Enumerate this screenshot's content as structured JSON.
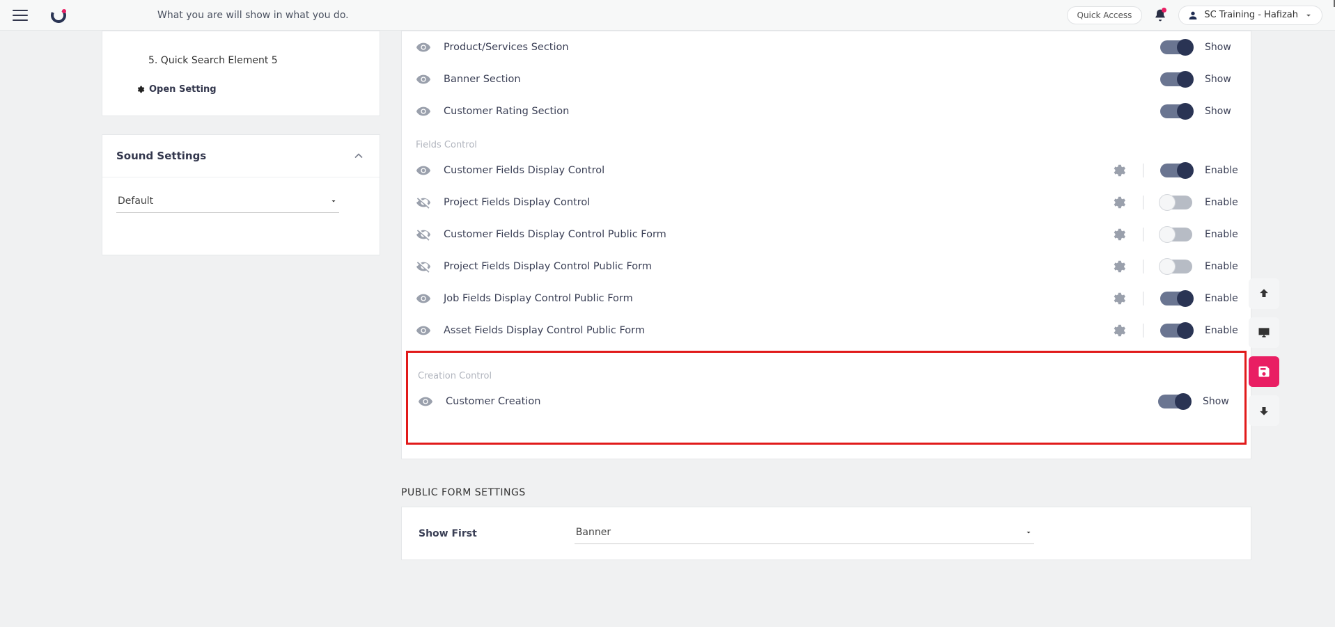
{
  "header": {
    "quote": "What you are will show in what you do.",
    "quick_access": "Quick Access",
    "user_name": "SC Training - Hafizah"
  },
  "left": {
    "qs_items": [
      "5.   Quick Search Element 5"
    ],
    "open_setting": "Open Setting",
    "sound_title": "Sound Settings",
    "sound_value": "Default"
  },
  "settings": {
    "rows_top": [
      {
        "label": "Product/Services Section",
        "status": "Show",
        "on": true,
        "visible": true,
        "gear": false
      },
      {
        "label": "Banner Section",
        "status": "Show",
        "on": true,
        "visible": true,
        "gear": false
      },
      {
        "label": "Customer Rating Section",
        "status": "Show",
        "on": true,
        "visible": true,
        "gear": false
      }
    ],
    "fields_group_label": "Fields Control",
    "rows_fields": [
      {
        "label": "Customer Fields Display Control",
        "status": "Enable",
        "on": true,
        "visible": true,
        "gear": true
      },
      {
        "label": "Project Fields Display Control",
        "status": "Enable",
        "on": false,
        "visible": false,
        "gear": true
      },
      {
        "label": "Customer Fields Display Control Public Form",
        "status": "Enable",
        "on": false,
        "visible": false,
        "gear": true
      },
      {
        "label": "Project Fields Display Control Public Form",
        "status": "Enable",
        "on": false,
        "visible": false,
        "gear": true
      },
      {
        "label": "Job Fields Display Control Public Form",
        "status": "Enable",
        "on": true,
        "visible": true,
        "gear": true
      },
      {
        "label": "Asset Fields Display Control Public Form",
        "status": "Enable",
        "on": true,
        "visible": true,
        "gear": true
      }
    ],
    "creation_group_label": "Creation Control",
    "rows_creation": [
      {
        "label": "Customer Creation",
        "status": "Show",
        "on": true,
        "visible": true,
        "gear": false
      }
    ]
  },
  "public_form": {
    "heading": "PUBLIC FORM SETTINGS",
    "show_first_label": "Show First",
    "show_first_value": "Banner"
  }
}
